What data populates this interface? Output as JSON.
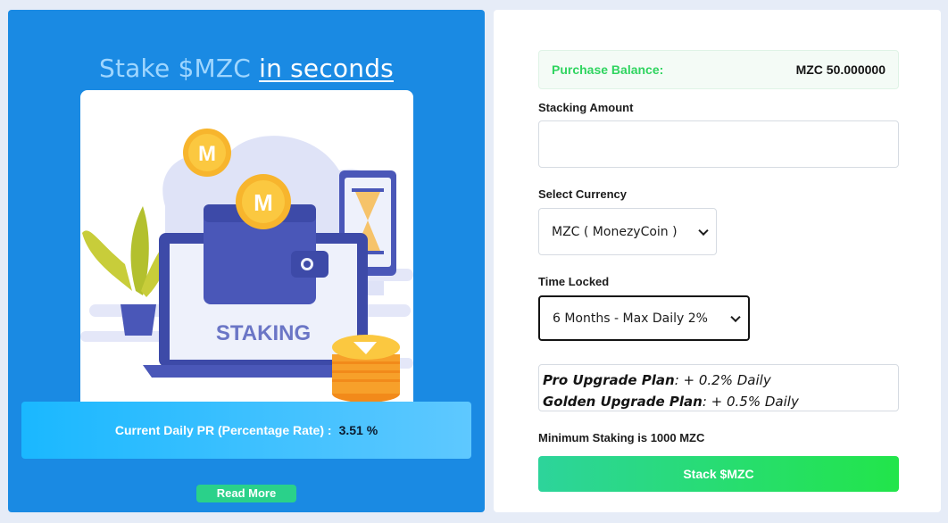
{
  "hero": {
    "title_prefix": "Stake $MZC ",
    "title_highlight": "in seconds",
    "illustration_text": "STAKING",
    "coin_letter": "M"
  },
  "rate": {
    "label": "Current Daily PR (Percentage Rate) :",
    "value": "3.51 %"
  },
  "read_more_label": "Read More",
  "form": {
    "balance_label": "Purchase Balance:",
    "balance_value": "MZC 50.000000",
    "amount_label": "Stacking Amount",
    "amount_value": "",
    "currency_label": "Select Currency",
    "currency_selected": "MZC ( MonezyCoin )",
    "time_label": "Time Locked",
    "time_selected": "6 Months - Max Daily 2%",
    "plans": [
      {
        "name": "Pro Upgrade Plan",
        "detail": ": + 0.2% Daily"
      },
      {
        "name": "Golden Upgrade Plan",
        "detail": ": + 0.5% Daily"
      }
    ],
    "min_prefix": "Minimum Staking is ",
    "min_value": "1000 MZC",
    "stake_button": "Stack $MZC"
  },
  "colors": {
    "left_panel": "#1a8ae3",
    "accent_green": "#22e54a",
    "balance_label": "#2fd45f"
  }
}
